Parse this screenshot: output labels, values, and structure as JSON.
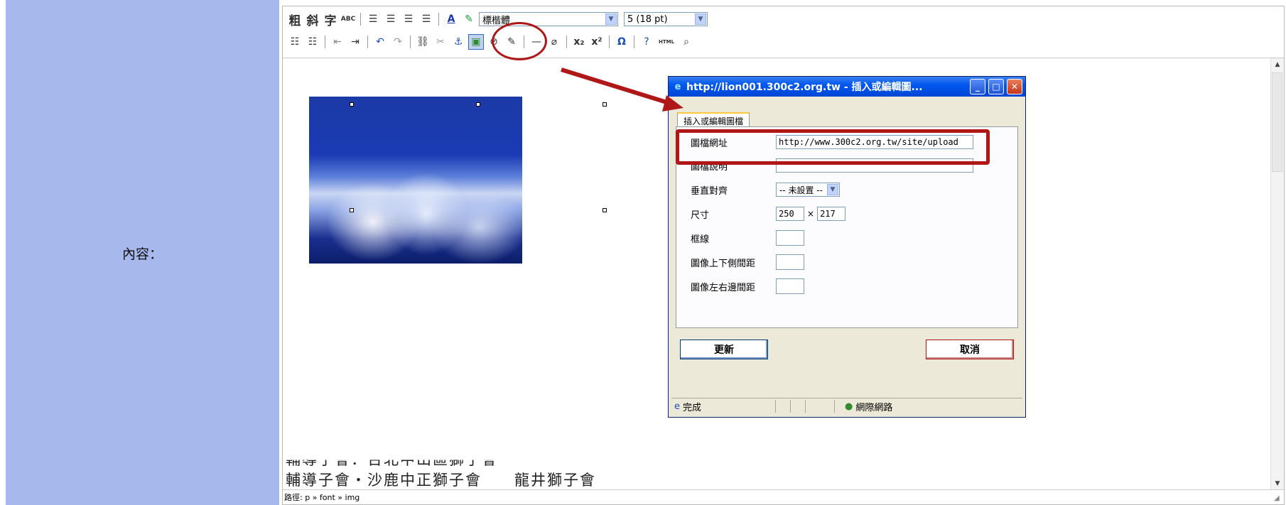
{
  "form": {
    "field_label": "內容："
  },
  "toolbar": {
    "bold": "粗",
    "italic": "斜",
    "underline": "字",
    "spellcheck": "ABC",
    "font_name": "標楷體",
    "font_size": "5 (18 pt)",
    "html_label": "HTML"
  },
  "editor": {
    "bottom_lines": [
      "輔導子會：台北中山區獅子會",
      "輔導子會‧沙鹿中正獅子會　　龍井獅子會"
    ],
    "path_label": "路徑: p » font » img"
  },
  "dialog": {
    "title": "http://lion001.300c2.org.tw - 插入或編輯圖...",
    "tab": "插入或編輯圖檔",
    "fields": {
      "url_label": "圖檔網址",
      "url_value": "http://www.300c2.org.tw/site/upload",
      "desc_label": "圖檔說明",
      "desc_value": "",
      "align_label": "垂直對齊",
      "align_value": "-- 未設置 --",
      "size_label": "尺寸",
      "width_value": "250",
      "times": "×",
      "height_value": "217",
      "border_label": "框線",
      "vspace_label": "圖像上下側間距",
      "hspace_label": "圖像左右邊間距"
    },
    "update_label": "更新",
    "cancel_label": "取消",
    "status_done": "完成",
    "status_zone": "網際網路"
  },
  "colors": {
    "highlight": "#b01818",
    "label_column": "#a7b9ec",
    "title_bar": "#0058ee"
  }
}
